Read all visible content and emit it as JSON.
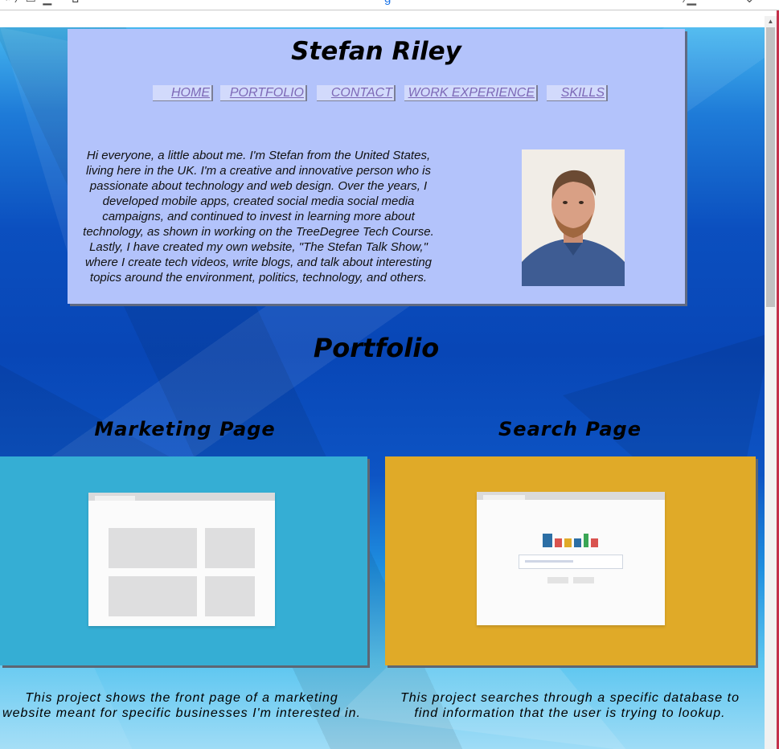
{
  "header": {
    "title": "Stefan Riley",
    "nav": [
      {
        "label": "HOME"
      },
      {
        "label": "PORTFOLIO"
      },
      {
        "label": "CONTACT"
      },
      {
        "label": "WORK EXPERIENCE"
      },
      {
        "label": "SKILLS"
      }
    ],
    "about": "Hi everyone, a little about me. I'm Stefan from the United States, living here in the UK. I'm a creative and innovative person who is passionate about technology and web design. Over the years, I developed mobile apps, created social media social media campaigns, and continued to invest in learning more about technology, as shown in working on the TreeDegree Tech Course. Lastly, I have created my own website, \"The Stefan Talk Show,\" where I create tech videos, write blogs, and talk about interesting topics around the environment, politics, technology, and others."
  },
  "portfolio": {
    "title": "Portfolio",
    "projects": [
      {
        "title": "Marketing Page",
        "description": "This project shows the front page of a marketing website meant for specific businesses I'm interested in.",
        "color": "#35aed4"
      },
      {
        "title": "Search Page",
        "description": "This project searches through a specific database to find information that the user is trying to lookup.",
        "color": "#e0aa28"
      }
    ]
  },
  "colors": {
    "header_bg": "#b3c3fb",
    "nav_text": "#7d69b7"
  }
}
